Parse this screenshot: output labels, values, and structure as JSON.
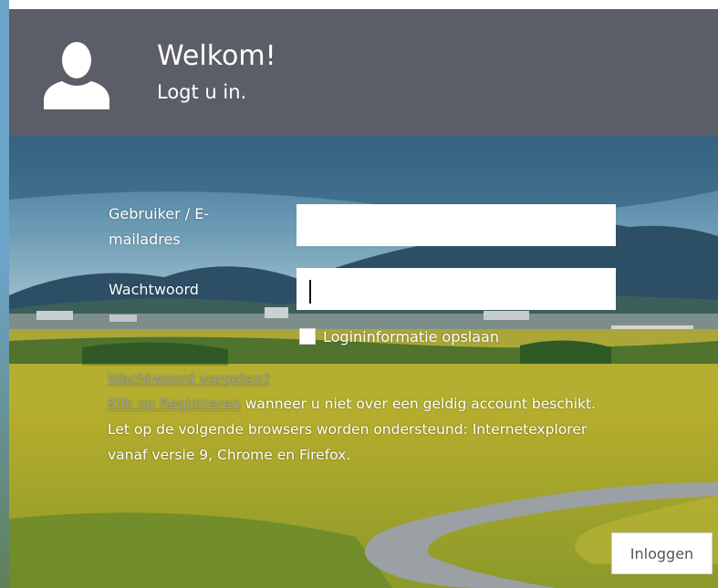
{
  "header": {
    "title": "Welkom!",
    "subtitle": "Logt u in.",
    "icon": "user-silhouette-icon"
  },
  "form": {
    "username_label_line1": "Gebruiker / E-",
    "username_label_line2": "mailadres",
    "username_value": "",
    "password_label": "Wachtwoord",
    "password_value": "",
    "remember_label": "Logininformatie opslaan",
    "remember_checked": false,
    "forgot_link": "Wachtwoord vergeten?",
    "register_link": "Klik op Registreren",
    "register_text": " wanneer u niet over een geldig account beschikt.",
    "browser_note_line1": "Let op de volgende browsers worden ondersteund: Internetexplorer",
    "browser_note_line2": "vanaf versie 9, Chrome en Firefox.",
    "login_button": "Inloggen"
  },
  "colors": {
    "header_bg": "#5b5e66",
    "link_muted": "#9aa39b",
    "text": "#ffffff"
  }
}
